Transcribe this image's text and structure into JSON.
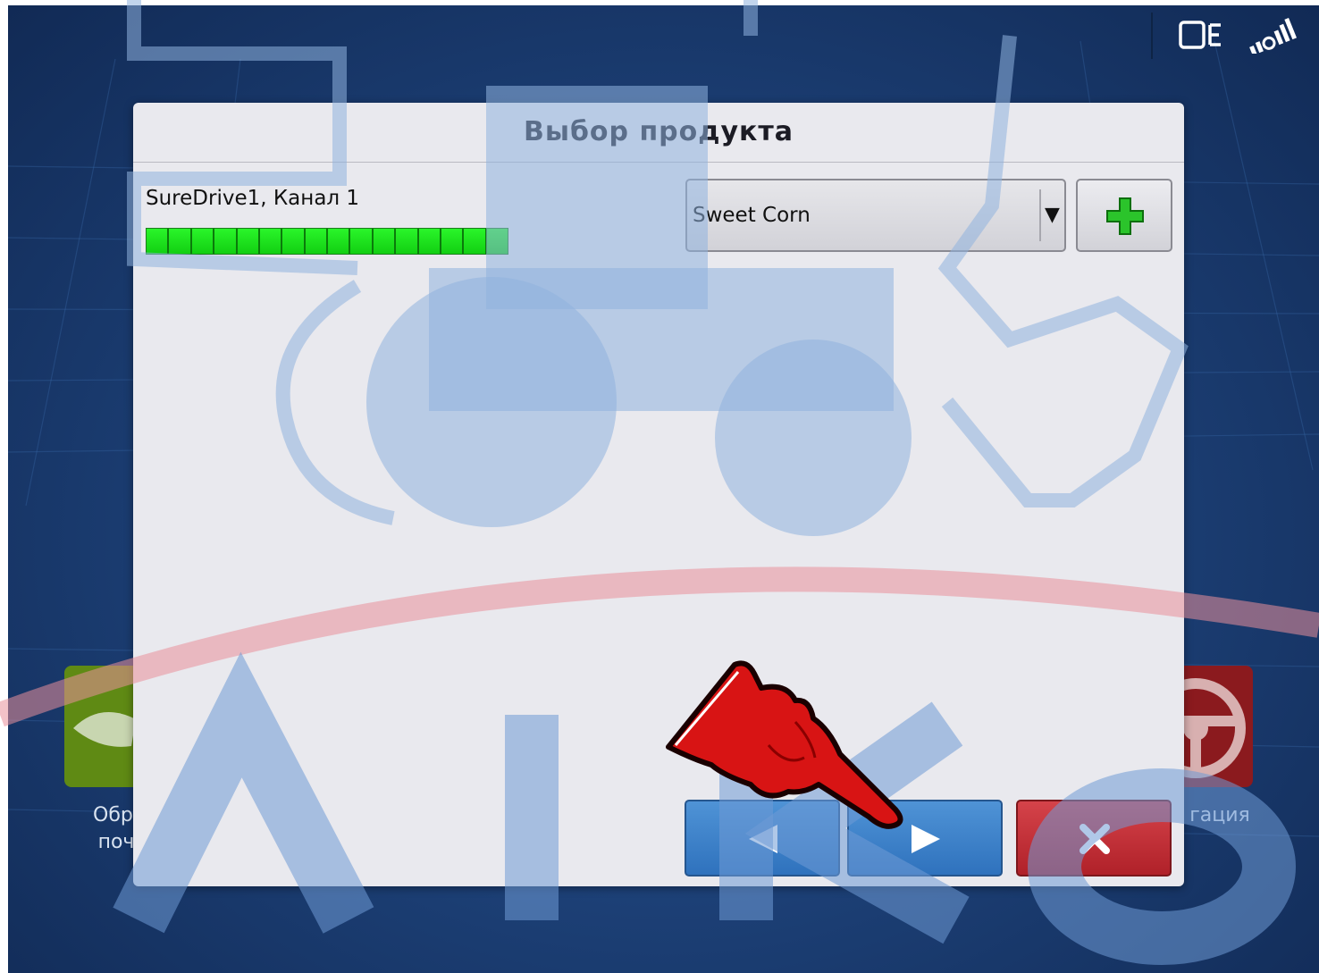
{
  "status_bar": {
    "icons": [
      "display-module-icon",
      "gps-signal-icon"
    ]
  },
  "background_tiles": {
    "left_label_line1": "Обраб",
    "left_label_line2": "поч",
    "right_label": "гация"
  },
  "dialog": {
    "title": "Выбор продукта",
    "channel_label": "SureDrive1, Канал 1",
    "progress_segments": 16,
    "product_select": {
      "value": "Sweet Corn",
      "arrow": "▼"
    },
    "buttons": {
      "add": "plus-icon",
      "prev": "arrow-left-icon",
      "next": "arrow-right-icon",
      "cancel": "close-icon"
    }
  },
  "watermark": {
    "text": "AIKO"
  },
  "colors": {
    "screen_bg": "#1d4178",
    "dialog_bg": "#e9e9ee",
    "progress_green": "#12cf12",
    "nav_blue": "#3b80c8",
    "cancel_red": "#c0303a",
    "add_green": "#22b422"
  }
}
